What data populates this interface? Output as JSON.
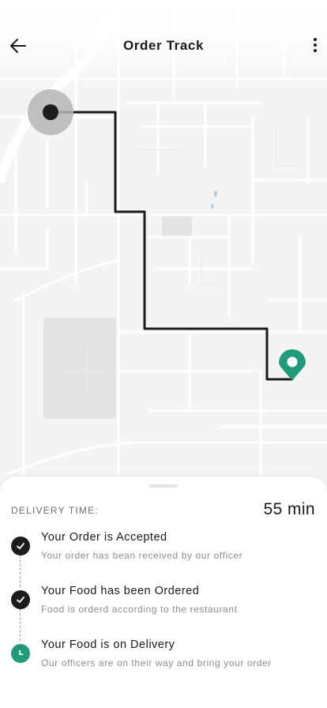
{
  "header": {
    "title": "Order Track"
  },
  "icons": {
    "back": "arrow-left-icon",
    "more": "more-vertical-icon",
    "origin": "location-dot-icon",
    "destination": "map-pin-icon",
    "done": "check-icon",
    "in_progress": "clock-icon"
  },
  "colors": {
    "accent": "#1f9a7a",
    "route": "#1c1c1c",
    "map_background": "#f4f4f5"
  },
  "delivery": {
    "label": "DELIVERY TIME:",
    "value": "55 min"
  },
  "steps": [
    {
      "title": "Your Order is Accepted",
      "subtitle": "Your order has bean received by our officer",
      "status": "done"
    },
    {
      "title": "Your Food has been Ordered",
      "subtitle": "Food is orderd according to the restaurant",
      "status": "done"
    },
    {
      "title": "Your Food is on Delivery",
      "subtitle": "Our officers are on their way and bring your order",
      "status": "in-progress"
    }
  ]
}
